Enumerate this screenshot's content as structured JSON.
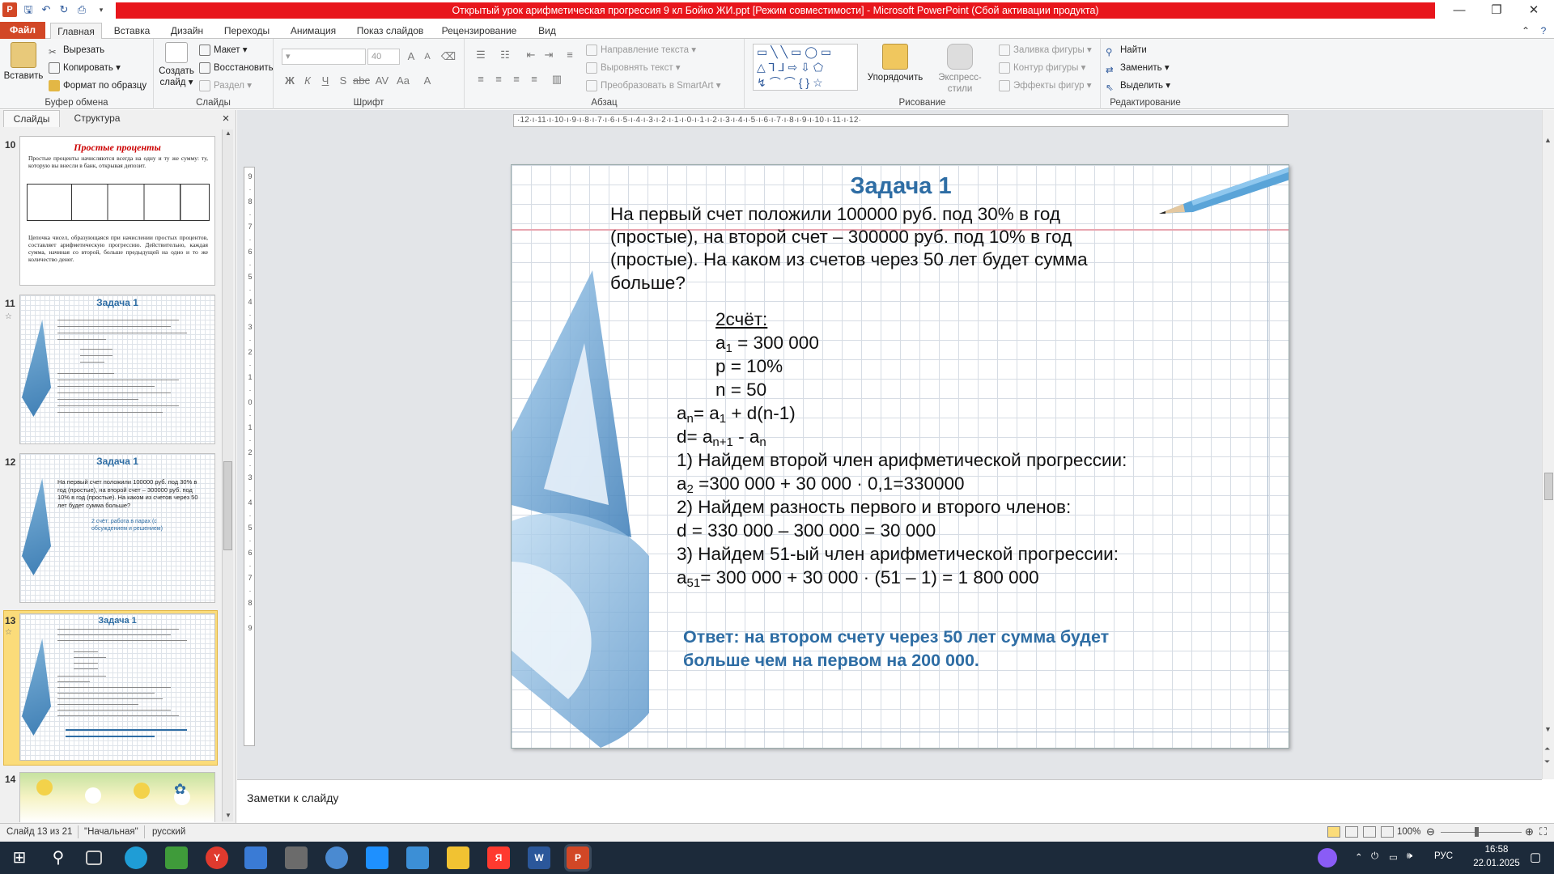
{
  "window": {
    "title": "Открытый урок арифметическая прогрессия 9 кл Бойко ЖИ.ppt [Режим совместимости] - Microsoft PowerPoint (Сбой активации продукта)",
    "minimize_glyph": "—",
    "restore_glyph": "❐",
    "close_glyph": "✕"
  },
  "tabs": [
    "Файл",
    "Главная",
    "Вставка",
    "Дизайн",
    "Переходы",
    "Анимация",
    "Показ слайдов",
    "Рецензирование",
    "Вид"
  ],
  "ribbon": {
    "clipboard": {
      "paste": "Вставить",
      "cut": "Вырезать",
      "copy": "Копировать",
      "format": "Формат по образцу",
      "label": "Буфер обмена"
    },
    "slides": {
      "new": "Создать слайд",
      "layout": "Макет",
      "reset": "Восстановить",
      "section": "Раздел",
      "label": "Слайды"
    },
    "font": {
      "size": "40",
      "label": "Шрифт"
    },
    "paragraph": {
      "direction": "Направление текста",
      "align": "Выровнять текст",
      "smartart": "Преобразовать в SmartArt",
      "label": "Абзац"
    },
    "drawing": {
      "arrange": "Упорядочить",
      "styles": "Экспресс-стили",
      "fill": "Заливка фигуры",
      "outline": "Контур фигуры",
      "effects": "Эффекты фигур",
      "label": "Рисование"
    },
    "editing": {
      "find": "Найти",
      "replace": "Заменить",
      "select": "Выделить",
      "label": "Редактирование"
    }
  },
  "panel": {
    "tab_slides": "Слайды",
    "tab_outline": "Структура",
    "close": "×"
  },
  "thumbnails": [
    {
      "num": "10",
      "title": "Простые проценты",
      "text": "Простые проценты начисляются всегда на одну и ту же сумму: ту, которую вы внесли в банк, открывая депозит.",
      "text2": "Цепочка чисел, образующаяся при начислении простых процентов, составляет арифметическую прогрессию. Действительно, каждая сумма, начиная со второй, больше предыдущей на одно и то же количество денег."
    },
    {
      "num": "11",
      "title": "Задача 1"
    },
    {
      "num": "12",
      "title": "Задача 1",
      "text": "На первый счет положили 100000 руб. под 30% в год (простые), на второй счет – 300000 руб. под 10% в год (простые). На каком из счетов через 50 лет будет сумма больше?",
      "text2": "2 счёт: работа в парах (с обсуждением и решением)"
    },
    {
      "num": "13",
      "title": "Задача 1"
    },
    {
      "num": "14"
    }
  ],
  "slide": {
    "title": "Задача 1",
    "problem": [
      "На первый счет положили 100000 руб. под 30% в год",
      "(простые), на второй счет – 300000 руб. под 10% в год",
      "(простые). На каком из счетов через 50 лет будет сумма",
      "больше?"
    ],
    "given_header": "2счёт:",
    "given": {
      "a1_pre": "a",
      "a1_sub": "1",
      "a1_post": " = 300 000",
      "p": "p = 10%",
      "n": "n = 50"
    },
    "formula1": {
      "a": "a",
      "sub": "n",
      "mid": "= a",
      "sub2": "1",
      "post": " + d(n-1)"
    },
    "formula2": {
      "pre": "d= a",
      "sub": "n+1",
      "mid": " - a",
      "sub2": "n"
    },
    "step1": "1) Найдем второй член арифметической прогрессии:",
    "step1calc": {
      "pre": "a",
      "sub": "2",
      "post": " =300 000 + 30 000 · 0,1=330000"
    },
    "step2": "2) Найдем разность первого и второго членов:",
    "step2calc": "d = 330 000 – 300 000 = 30 000",
    "step3": "3) Найдем 51-ый член арифметической прогрессии:",
    "step3calc": {
      "pre": "a",
      "sub": "51",
      "post": "= 300 000 + 30 000 · (51 – 1) = 1 800 000"
    },
    "answer": [
      "Ответ:  на втором счету через 50 лет сумма будет",
      "больше чем на первом на 200 000."
    ]
  },
  "notes": {
    "placeholder": "Заметки к слайду"
  },
  "status": {
    "slide": "Слайд 13 из 21",
    "theme": "\"Начальная\"",
    "lang": "русский",
    "zoom": "100%"
  },
  "taskbar": {
    "lang": "РУС",
    "time": "16:58",
    "date": "22.01.2025"
  },
  "colors": {
    "title_blue": "#2e6da4",
    "answer_blue": "#2e6da4",
    "file_tab": "#d24726",
    "title_red": "#e8161c"
  }
}
